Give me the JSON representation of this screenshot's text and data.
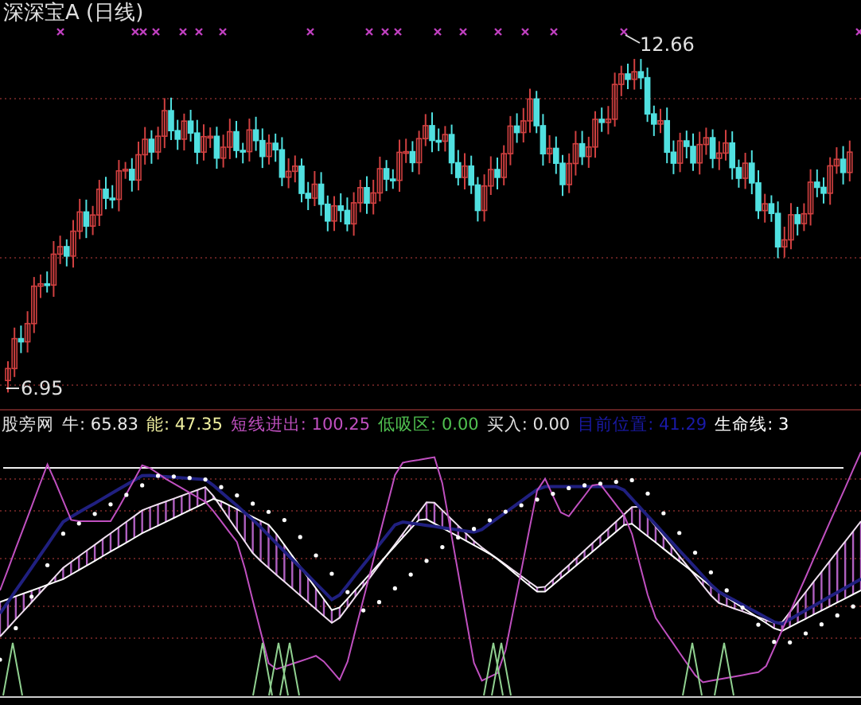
{
  "chart_title": "深深宝A (日线)",
  "price_labels": {
    "high": "12.66",
    "low": "6.95"
  },
  "indicator": {
    "name": "股旁网",
    "values": [
      {
        "label": "牛:",
        "value": "65.83",
        "color": "#e8e8e8"
      },
      {
        "label": "能:",
        "value": "47.35",
        "color": "#f0f0a0"
      },
      {
        "label": "短线进出:",
        "value": "100.25",
        "color": "#c050c0"
      },
      {
        "label": "低吸区:",
        "value": "0.00",
        "color": "#50c050"
      },
      {
        "label": "买入:",
        "value": "0.00",
        "color": "#e0e0e0"
      },
      {
        "label": "目前位置:",
        "value": "41.29",
        "color": "#1a1aa8"
      },
      {
        "label": "生命线:",
        "value": "3",
        "color": "#ffffff"
      }
    ]
  }
}
